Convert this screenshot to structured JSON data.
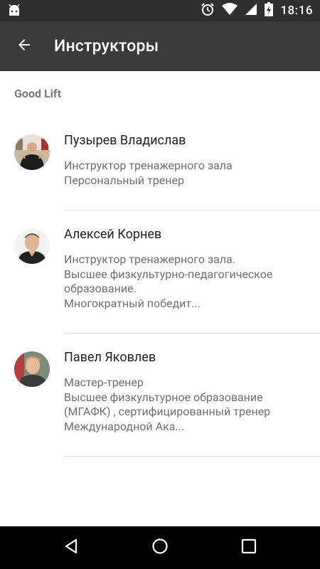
{
  "status_bar": {
    "time": "18:16",
    "icons": [
      "android-icon",
      "alarm-icon",
      "wifi-icon",
      "signal-icon",
      "battery-icon"
    ]
  },
  "app_bar": {
    "title": "Инструкторы",
    "back_icon": "arrow-back-icon"
  },
  "section": {
    "header": "Good Lift"
  },
  "instructors": [
    {
      "name": "Пузырев Владислав",
      "description": "Инструктор тренажерного зала\nПерсональный тренер",
      "avatar": "avatar-photo"
    },
    {
      "name": "Алексей Корнев",
      "description": "Инструктор тренажерного зала.\nВысшее физкультурно-педагогическое образование.\nМногократный победит...",
      "avatar": "avatar-photo"
    },
    {
      "name": "Павел Яковлев",
      "description": "Мастер-тренер\nВысшее физкультурное образование (МГАФК) , сертифицированный тренер Международной Ака...",
      "avatar": "avatar-photo"
    }
  ],
  "nav_bar": {
    "icons": [
      "back-triangle-icon",
      "home-circle-icon",
      "recents-square-icon"
    ]
  },
  "colors": {
    "status_bar": "#2f2f2f",
    "app_bar": "#3a3a3a",
    "section_header": "#7a7a7a",
    "title_text": "#222222",
    "subtitle_text": "#6f6f6f",
    "divider": "#e0e0e0"
  }
}
